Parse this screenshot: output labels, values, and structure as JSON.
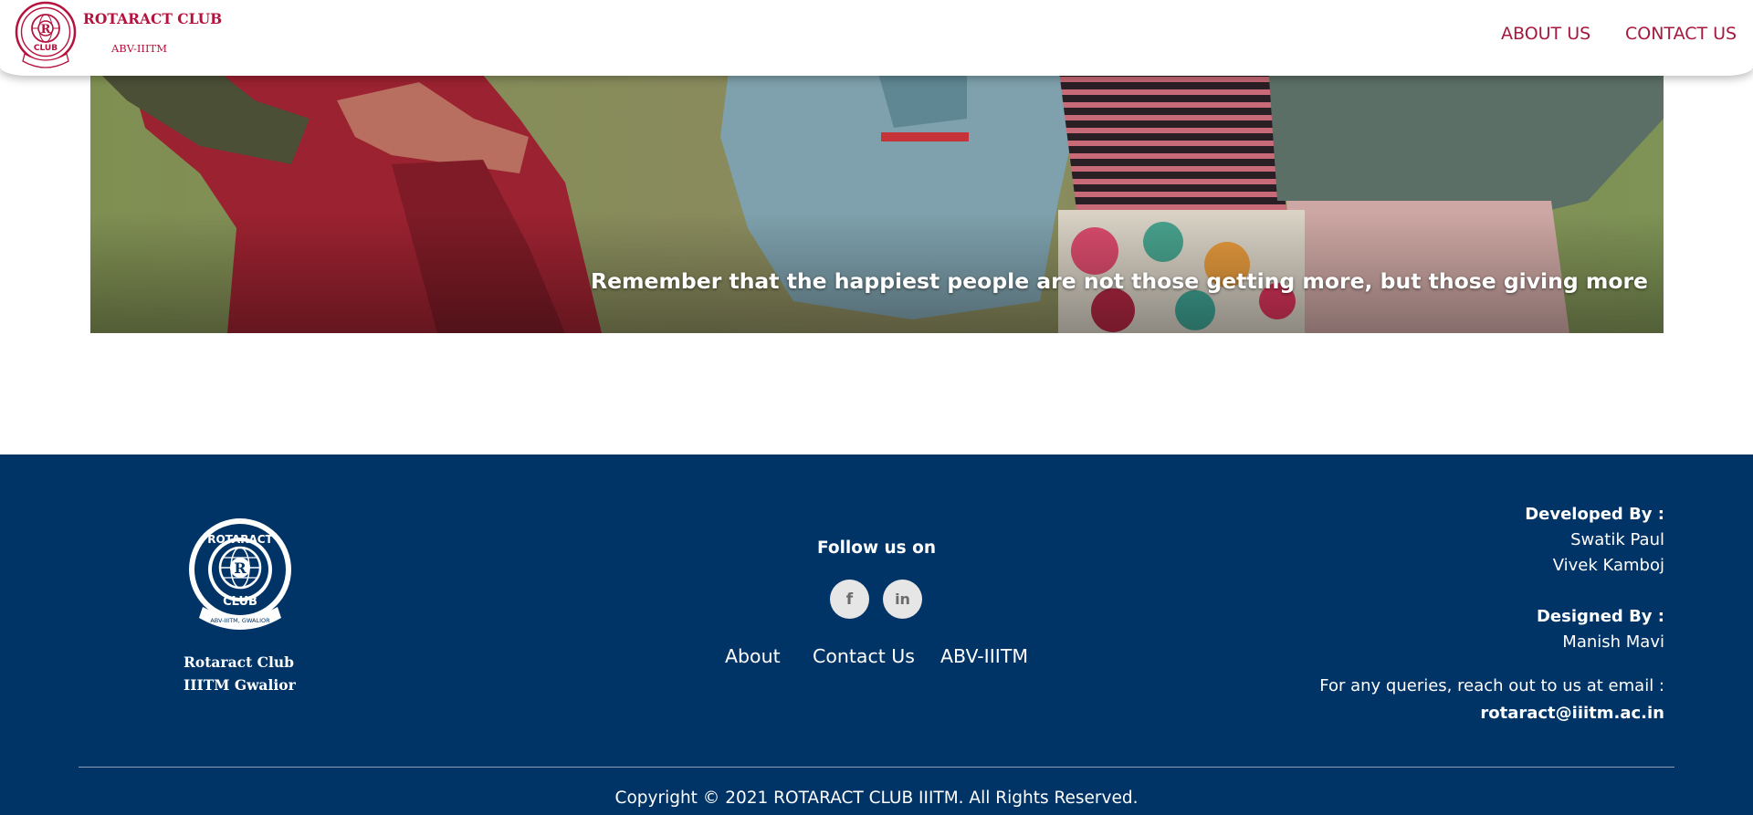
{
  "header": {
    "brand_name": "ROTARACT CLUB",
    "brand_sub": "ABV-IIITM",
    "nav": [
      {
        "label": "ABOUT US"
      },
      {
        "label": "CONTACT US"
      }
    ],
    "brand_color": "#b5123e"
  },
  "logo": {
    "top_text": "ROTARACT",
    "bottom_text": "CLUB",
    "ribbon_text": "ABV-IIITM, GWALIOR",
    "emblem_letter": "R"
  },
  "hero": {
    "quote": "Remember that the happiest people are not those getting more, but those giving more"
  },
  "footer": {
    "background": "#003366",
    "club_line1": "Rotaract Club",
    "club_line2": "IIITM Gwalior",
    "follow_title": "Follow us on",
    "social": [
      {
        "icon": "facebook-icon",
        "glyph": "f"
      },
      {
        "icon": "linkedin-icon",
        "glyph": "in"
      }
    ],
    "links": [
      {
        "label": "About"
      },
      {
        "label": "Contact Us"
      },
      {
        "label": "ABV-IIITM"
      }
    ],
    "developed_label": "Developed By :",
    "developers": [
      "Swatik Paul",
      "Vivek Kamboj"
    ],
    "designed_label": "Designed By :",
    "designers": [
      "Manish Mavi"
    ],
    "query_text": "For any queries, reach out to us at email :",
    "email": "rotaract@iiitm.ac.in",
    "copyright": "Copyright © 2021 ROTARACT CLUB IIITM. All Rights Reserved."
  }
}
